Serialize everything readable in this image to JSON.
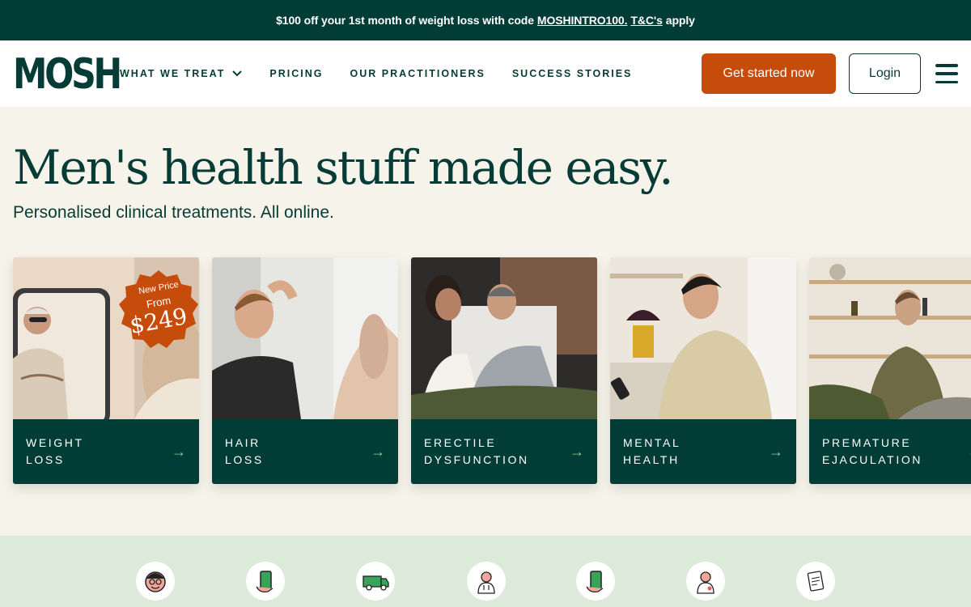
{
  "promo": {
    "text_before": "$100 off your 1st month of weight loss with code",
    "code": "MOSHINTRO100.",
    "terms": "T&C's",
    "text_after": "apply"
  },
  "nav": {
    "logo": "MOSH",
    "menu": [
      "WHAT WE TREAT",
      "PRICING",
      "OUR PRACTITIONERS",
      "SUCCESS STORIES"
    ],
    "cta": "Get started now",
    "login": "Login"
  },
  "hero": {
    "title": "Men's health stuff made easy.",
    "subtitle": "Personalised clinical treatments. All online."
  },
  "cards": [
    {
      "label": "WEIGHT\nLOSS",
      "badge": {
        "line1": "New Price",
        "line2": "From",
        "price": "$249"
      }
    },
    {
      "label": "HAIR\nLOSS"
    },
    {
      "label": "ERECTILE\nDYSFUNCTION"
    },
    {
      "label": "MENTAL\nHEALTH"
    },
    {
      "label": "PREMATURE\nEJACULATION"
    }
  ],
  "feature_icons": [
    "smiling-man-icon",
    "phone-in-hand-icon",
    "delivery-van-icon",
    "doctor-icon",
    "phone-in-hand-icon",
    "doctor-icon",
    "clipboard-icon"
  ],
  "colors": {
    "primary_dark": "#023c37",
    "accent_orange": "#c64c0b",
    "background_cream": "#f6f4ea",
    "band_green": "#dcebd9",
    "arrow_green": "#8ed19a"
  }
}
